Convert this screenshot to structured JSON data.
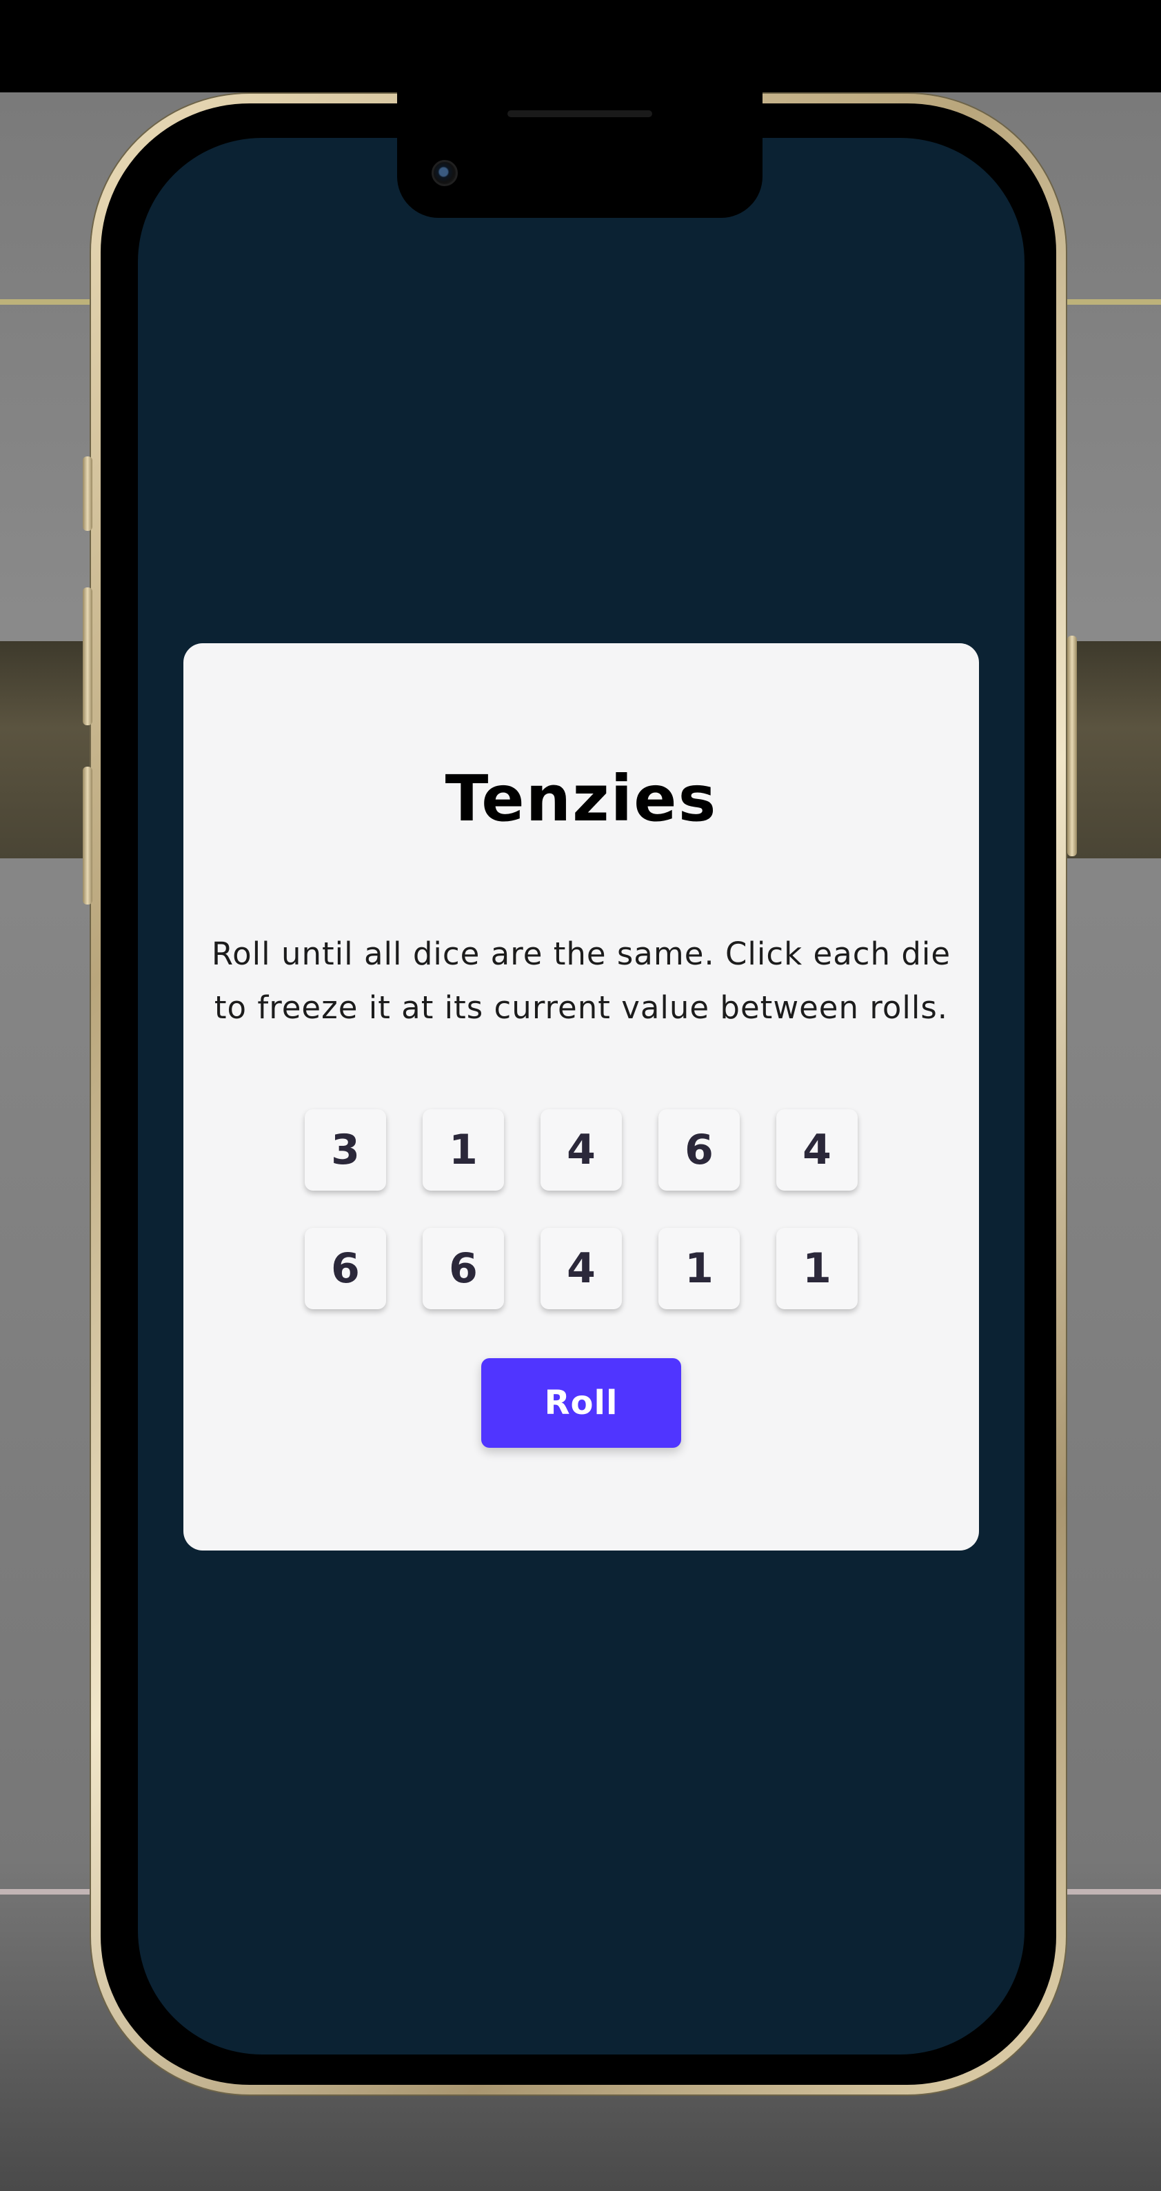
{
  "app": {
    "title": "Tenzies",
    "instructions": "Roll until all dice are the same. Click each die to freeze it at its current value between rolls.",
    "dice": [
      "3",
      "1",
      "4",
      "6",
      "4",
      "6",
      "6",
      "4",
      "1",
      "1"
    ],
    "roll_label": "Roll"
  },
  "colors": {
    "screen_background": "#0b2233",
    "card_background": "#f5f5f6",
    "die_text": "#2b283a",
    "roll_button": "#5035ff"
  }
}
